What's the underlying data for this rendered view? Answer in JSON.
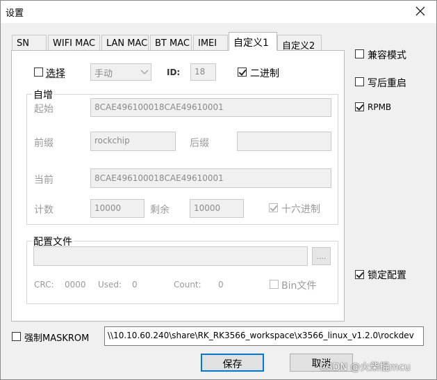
{
  "window": {
    "title": "设置"
  },
  "tabs": [
    {
      "label": "SN"
    },
    {
      "label": "WIFI MAC"
    },
    {
      "label": "LAN MAC"
    },
    {
      "label": "BT MAC"
    },
    {
      "label": "IMEI"
    },
    {
      "label": "自定义1"
    },
    {
      "label": "自定义2"
    }
  ],
  "custom": {
    "select_label": "选择",
    "mode_value": "手动",
    "id_label": "ID:",
    "id_value": "18",
    "binary_label": "二进制"
  },
  "increment": {
    "group_label": "自增",
    "start_label": "起始",
    "start_value": "8CAE496100018CAE49610001",
    "prefix_label": "前缀",
    "prefix_value": "rockchip",
    "suffix_label": "后缀",
    "suffix_value": "",
    "current_label": "当前",
    "current_value": "8CAE496100018CAE49610001",
    "count_label": "计数",
    "count_value": "10000",
    "remain_label": "剩余",
    "remain_value": "10000",
    "hex_label": "十六进制"
  },
  "config": {
    "group_label": "配置文件",
    "path_value": "",
    "browse_label": "....",
    "crc_label": "CRC:",
    "crc_value": "0000",
    "used_label": "Used:",
    "used_value": "0",
    "count_label": "Count:",
    "count_value": "0",
    "bin_label": "Bin文件"
  },
  "right": {
    "compat_label": "兼容模式",
    "reboot_label": "写后重启",
    "rpmb_label": "RPMB",
    "lock_label": "锁定配置"
  },
  "bottom": {
    "maskrom_label": "强制MASKROM",
    "path_value": "\\\\10.10.60.240\\share\\RK_RK3566_workspace\\x3566_linux_v1.2.0\\rockdev",
    "save_label": "保存",
    "cancel_label": "取消"
  },
  "watermark": "CSDN @火柴棍mcu"
}
